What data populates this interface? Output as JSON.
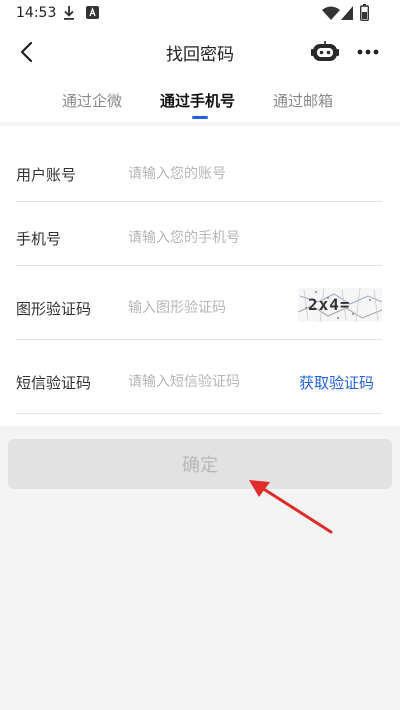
{
  "status_bar": {
    "time": "14:53",
    "icons": [
      "download-icon",
      "a-badge-icon",
      "wifi-icon",
      "signal-icon",
      "battery-icon"
    ]
  },
  "header": {
    "title": "找回密码",
    "back_icon": "chevron-left-icon",
    "robot_icon": "robot-icon",
    "more_icon": "more-dots-icon"
  },
  "tabs": [
    {
      "label": "通过企微",
      "active": false
    },
    {
      "label": "通过手机号",
      "active": true
    },
    {
      "label": "通过邮箱",
      "active": false
    }
  ],
  "form": {
    "account": {
      "label": "用户账号",
      "placeholder": "请输入您的账号"
    },
    "phone": {
      "label": "手机号",
      "placeholder": "请输入您的手机号"
    },
    "image_code": {
      "label": "图形验证码",
      "placeholder": "输入图形验证码",
      "captcha_text": "2x4="
    },
    "sms_code": {
      "label": "短信验证码",
      "placeholder": "请输入短信验证码",
      "get_code_label": "获取验证码"
    }
  },
  "confirm_label": "确定",
  "colors": {
    "accent": "#2463e0",
    "annotation_arrow": "#e12a2a",
    "disabled_button_bg": "#e2e2e2"
  }
}
